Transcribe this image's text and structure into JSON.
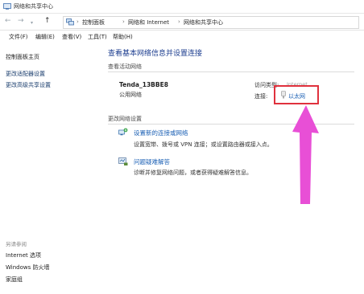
{
  "window": {
    "title": "网络和共享中心"
  },
  "nav": {
    "breadcrumbs": [
      "控制面板",
      "网络和 Internet",
      "网络和共享中心"
    ]
  },
  "menu": {
    "items": [
      "文件(F)",
      "编辑(E)",
      "查看(V)",
      "工具(T)",
      "帮助(H)"
    ]
  },
  "sidebar": {
    "links": [
      "控制面板主页",
      "更改适配器设置",
      "更改高级共享设置"
    ],
    "see_also_label": "另请参阅",
    "see_also": [
      "Internet 选项",
      "Windows 防火墙",
      "家庭组"
    ]
  },
  "main": {
    "heading": "查看基本网络信息并设置连接",
    "active_section": "查看活动网络",
    "network_name": "Tenda_13BBE8",
    "network_type": "公用网络",
    "access_type_label": "访问类型:",
    "access_type_value": "Internet",
    "connection_label": "连接:",
    "connection_value": "以太网",
    "change_section": "更改网络设置",
    "tasks": [
      {
        "title": "设置新的连接或网络",
        "desc": "设置宽带、拨号或 VPN 连接；或设置路由器或接入点。"
      },
      {
        "title": "问题疑难解答",
        "desc": "诊断并修复网络问题，或者获得疑难解答信息。"
      }
    ]
  },
  "colors": {
    "highlight": "#e0313d",
    "arrow": "#e84fd6",
    "link": "#1a5fb4"
  }
}
